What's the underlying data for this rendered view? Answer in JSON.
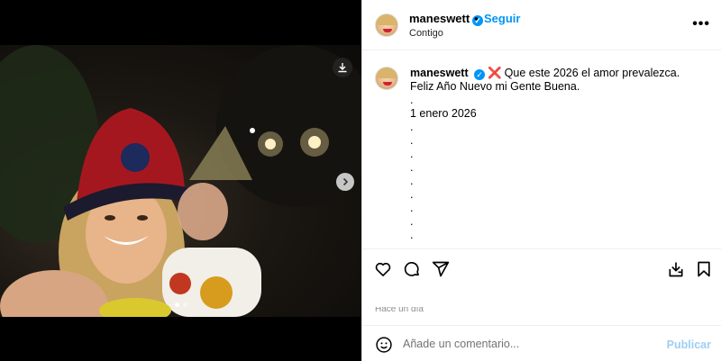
{
  "post": {
    "username": "maneswett",
    "verified_glyph": "✓",
    "separator": "•",
    "follow_label": "Seguir",
    "audience": "Contigo",
    "more_label": "•••"
  },
  "caption": {
    "username": "maneswett",
    "emoji": "❌",
    "text": "Que este 2026 el amor prevalezca. Feliz Año Nuevo mi Gente Buena.",
    "lines": [
      ".",
      "1 enero 2026",
      ".",
      ".",
      ".",
      ".",
      ".",
      ".",
      ".",
      ".",
      ".",
      "."
    ]
  },
  "actions": {
    "like_icon": "heart-icon",
    "comment_icon": "comment-icon",
    "share_icon": "share-icon",
    "save_icon": "bookmark-icon",
    "download_icon": "download-icon",
    "time_label": "Hace un día"
  },
  "comment_box": {
    "placeholder": "Añade un comentario...",
    "publish_label": "Publicar"
  },
  "media": {
    "slide_count": 2,
    "active_slide": 1
  },
  "colors": {
    "accent": "#0095f6",
    "publish_disabled": "#9ccff6",
    "cross": "#e0245e"
  }
}
